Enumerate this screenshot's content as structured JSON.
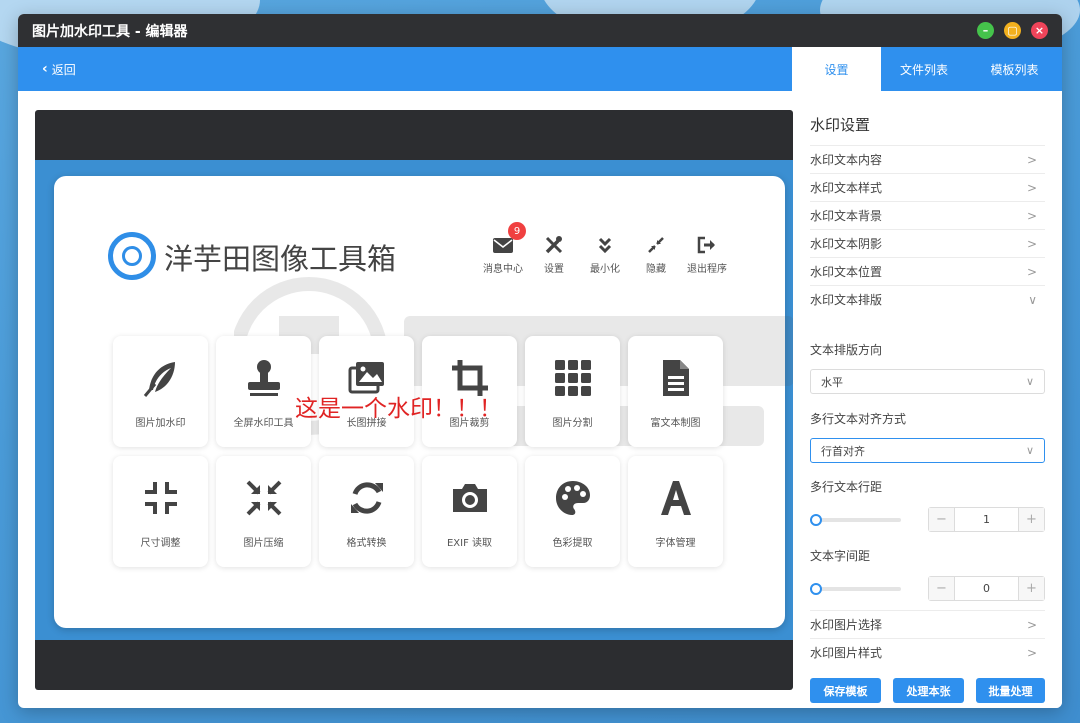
{
  "window": {
    "title": "图片加水印工具 - 编辑器",
    "controls": {
      "minimize": "–",
      "maximize": "▢",
      "close": "×"
    }
  },
  "nav": {
    "back_label": "返回",
    "tabs": [
      "设置",
      "文件列表",
      "模板列表"
    ],
    "active_tab": 0
  },
  "preview": {
    "brand": "洋芋田图像工具箱",
    "watermark_text": "这是一个水印！！！",
    "top_icons": [
      {
        "label": "消息中心",
        "icon": "mail-icon",
        "badge": "9"
      },
      {
        "label": "设置",
        "icon": "tools-icon"
      },
      {
        "label": "最小化",
        "icon": "double-chevron-down-icon"
      },
      {
        "label": "隐藏",
        "icon": "compress-arrows-icon"
      },
      {
        "label": "退出程序",
        "icon": "exit-icon"
      }
    ],
    "tools": [
      {
        "label": "图片加水印",
        "icon": "feather-icon"
      },
      {
        "label": "全屏水印工具",
        "icon": "stamp-icon"
      },
      {
        "label": "长图拼接",
        "icon": "images-icon"
      },
      {
        "label": "图片裁剪",
        "icon": "crop-icon"
      },
      {
        "label": "图片分割",
        "icon": "grid-icon"
      },
      {
        "label": "富文本制图",
        "icon": "document-icon"
      },
      {
        "label": "尺寸调整",
        "icon": "resize-icon"
      },
      {
        "label": "图片压缩",
        "icon": "compress-icon"
      },
      {
        "label": "格式转换",
        "icon": "refresh-icon"
      },
      {
        "label": "EXIF 读取",
        "icon": "camera-icon"
      },
      {
        "label": "色彩提取",
        "icon": "palette-icon"
      },
      {
        "label": "字体管理",
        "icon": "font-icon"
      }
    ]
  },
  "settings": {
    "heading": "水印设置",
    "sections": [
      {
        "label": "水印文本内容",
        "expanded": false
      },
      {
        "label": "水印文本样式",
        "expanded": false
      },
      {
        "label": "水印文本背景",
        "expanded": false
      },
      {
        "label": "水印文本阴影",
        "expanded": false
      },
      {
        "label": "水印文本位置",
        "expanded": false
      },
      {
        "label": "水印文本排版",
        "expanded": true
      }
    ],
    "direction_label": "文本排版方向",
    "direction_value": "水平",
    "align_label": "多行文本对齐方式",
    "align_value": "行首对齐",
    "line_spacing_label": "多行文本行距",
    "line_spacing_value": "1",
    "letter_spacing_label": "文本字间距",
    "letter_spacing_value": "0",
    "stepper_minus": "−",
    "stepper_plus": "+",
    "bottom_sections": [
      {
        "label": "水印图片选择"
      },
      {
        "label": "水印图片样式"
      }
    ],
    "buttons": [
      "保存模板",
      "处理本张",
      "批量处理"
    ]
  },
  "colors": {
    "accent": "#2f90ee",
    "titlebar": "#2f3033",
    "watermark": "#e02424"
  }
}
